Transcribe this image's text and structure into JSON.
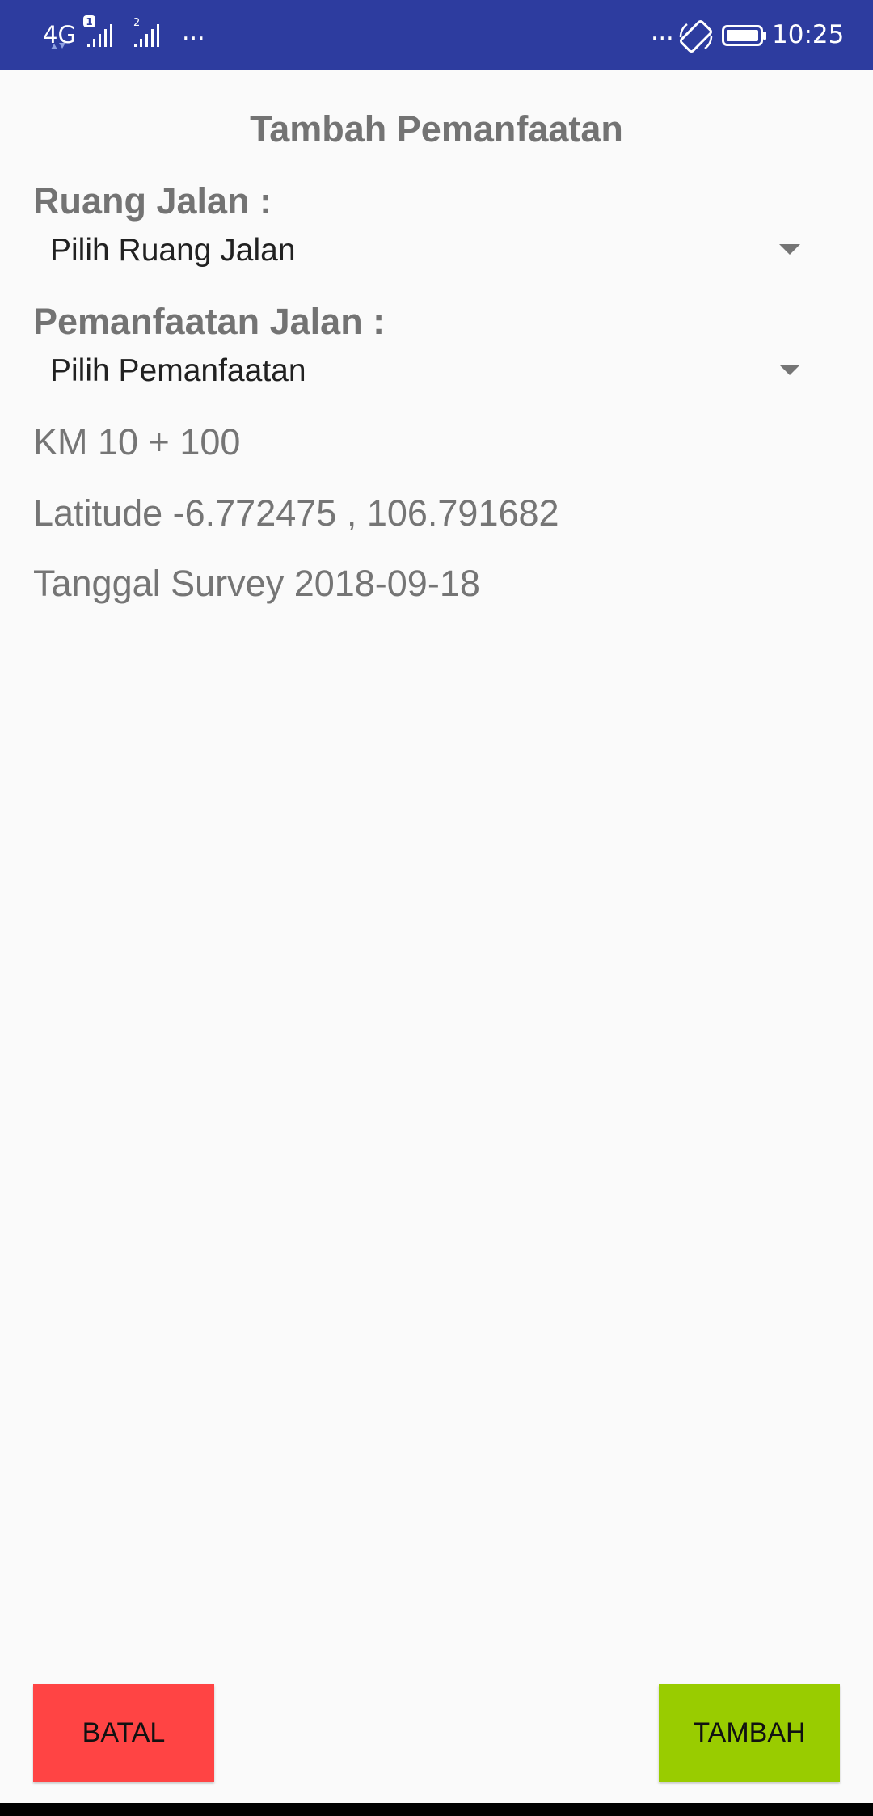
{
  "status_bar": {
    "network": "4G",
    "sim1_badge": "1",
    "sim2_badge": "2",
    "more_left": "...",
    "more_right": "...",
    "time": "10:25",
    "icons": [
      "network-arrows-icon",
      "signal-sim1-icon",
      "signal-sim2-icon",
      "auto-rotate-icon",
      "battery-icon"
    ]
  },
  "page": {
    "title": "Tambah Pemanfaatan"
  },
  "form": {
    "ruang_label": "Ruang Jalan :",
    "ruang_value": "Pilih Ruang Jalan",
    "pemanfaatan_label": "Pemanfaatan Jalan :",
    "pemanfaatan_value": "Pilih Pemanfaatan",
    "km": "KM 10 + 100",
    "latitude": "Latitude -6.772475 , 106.791682",
    "tanggal": "Tanggal Survey 2018-09-18"
  },
  "buttons": {
    "batal": "BATAL",
    "tambah": "TAMBAH"
  },
  "colors": {
    "status_bar": "#2d3c9f",
    "background": "#fafafa",
    "batal": "#ff4444",
    "tambah": "#99cc00",
    "label_text": "#737373"
  }
}
